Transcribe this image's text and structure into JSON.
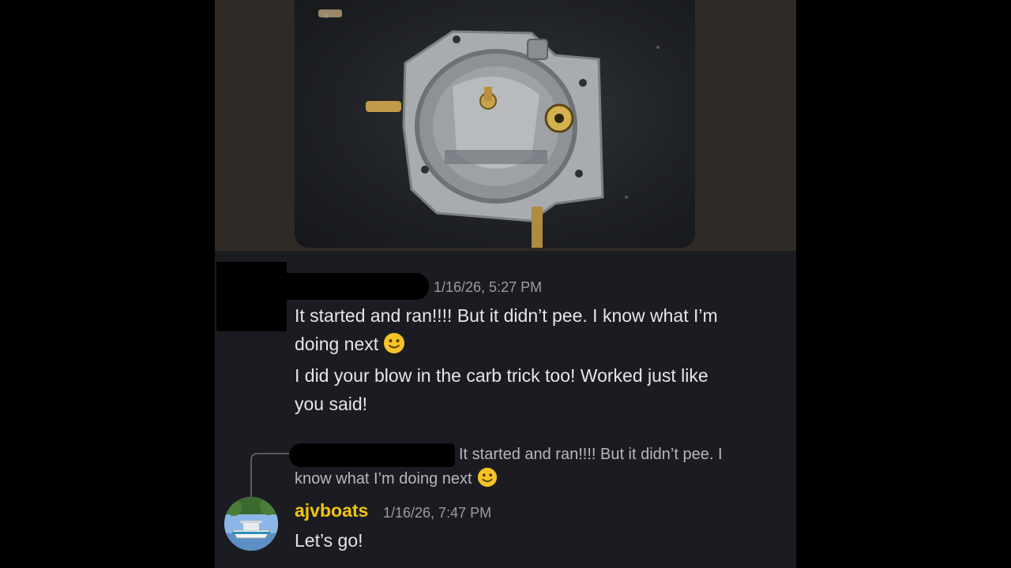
{
  "message1": {
    "timestamp": "1/16/26, 5:27 PM",
    "line1": "It started and ran!!!! But it didn’t pee. I know what I’m",
    "line2": "doing next",
    "line3": "I did your blow in the carb trick too! Worked just like",
    "line4": "you said!"
  },
  "reply": {
    "quote_line1": "It started and ran!!!! But it didn’t pee. I",
    "quote_line2": "know what I’m doing next"
  },
  "message2": {
    "username": "ajvboats",
    "timestamp": "1/16/26, 7:47 PM",
    "text": "Let’s go!"
  },
  "icons": {
    "emoji": "slightly-smiling-face",
    "avatar": "boat-photo",
    "attachment": "carburetor-photo"
  },
  "colors": {
    "username": "#f1c40f",
    "background": "#1b1c21",
    "text": "#e6e6e9",
    "timestamp": "#9a9ca3"
  }
}
